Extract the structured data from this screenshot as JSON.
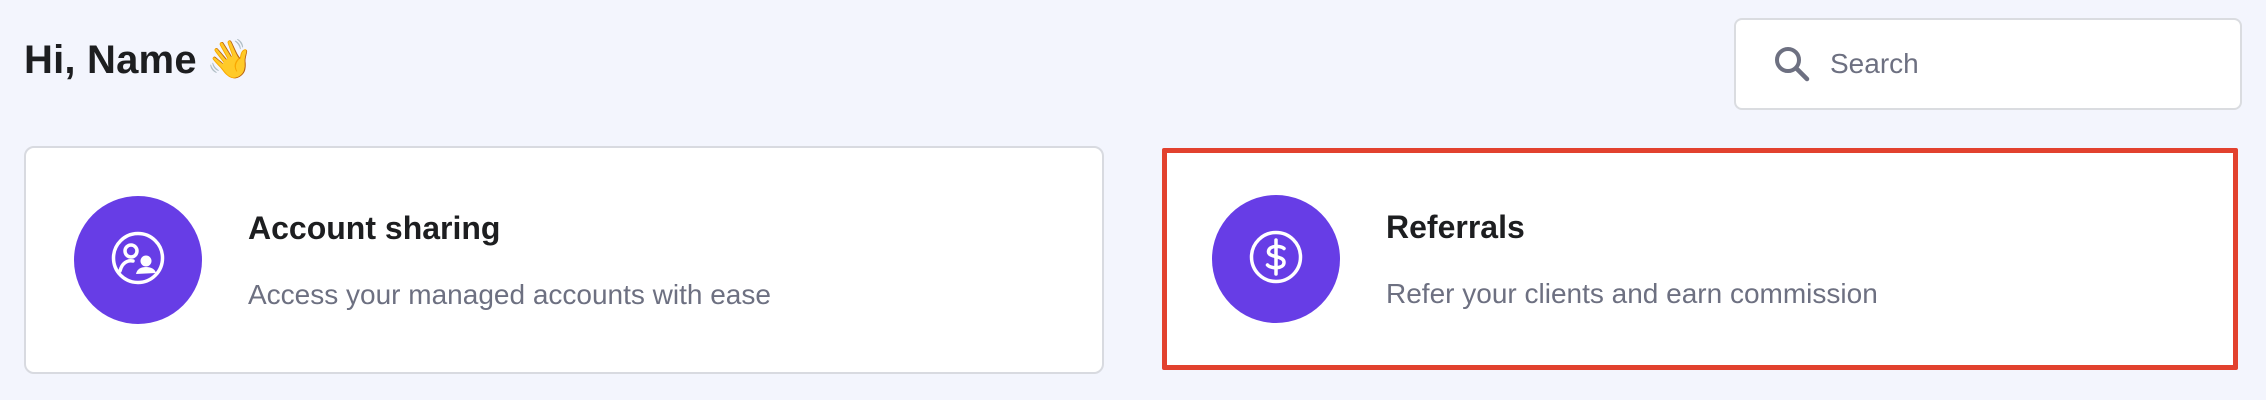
{
  "header": {
    "greeting": "Hi, Name",
    "greeting_emoji": "👋"
  },
  "search": {
    "placeholder": "Search",
    "value": ""
  },
  "cards": [
    {
      "title": "Account sharing",
      "description": "Access your managed accounts with ease",
      "icon": "account-sharing-icon"
    },
    {
      "title": "Referrals",
      "description": "Refer your clients and earn commission",
      "icon": "dollar-circle-icon"
    }
  ],
  "colors": {
    "accent": "#673de6",
    "highlight_border": "#e2412e",
    "background": "#f3f5fd",
    "muted_text": "#6d7081"
  }
}
